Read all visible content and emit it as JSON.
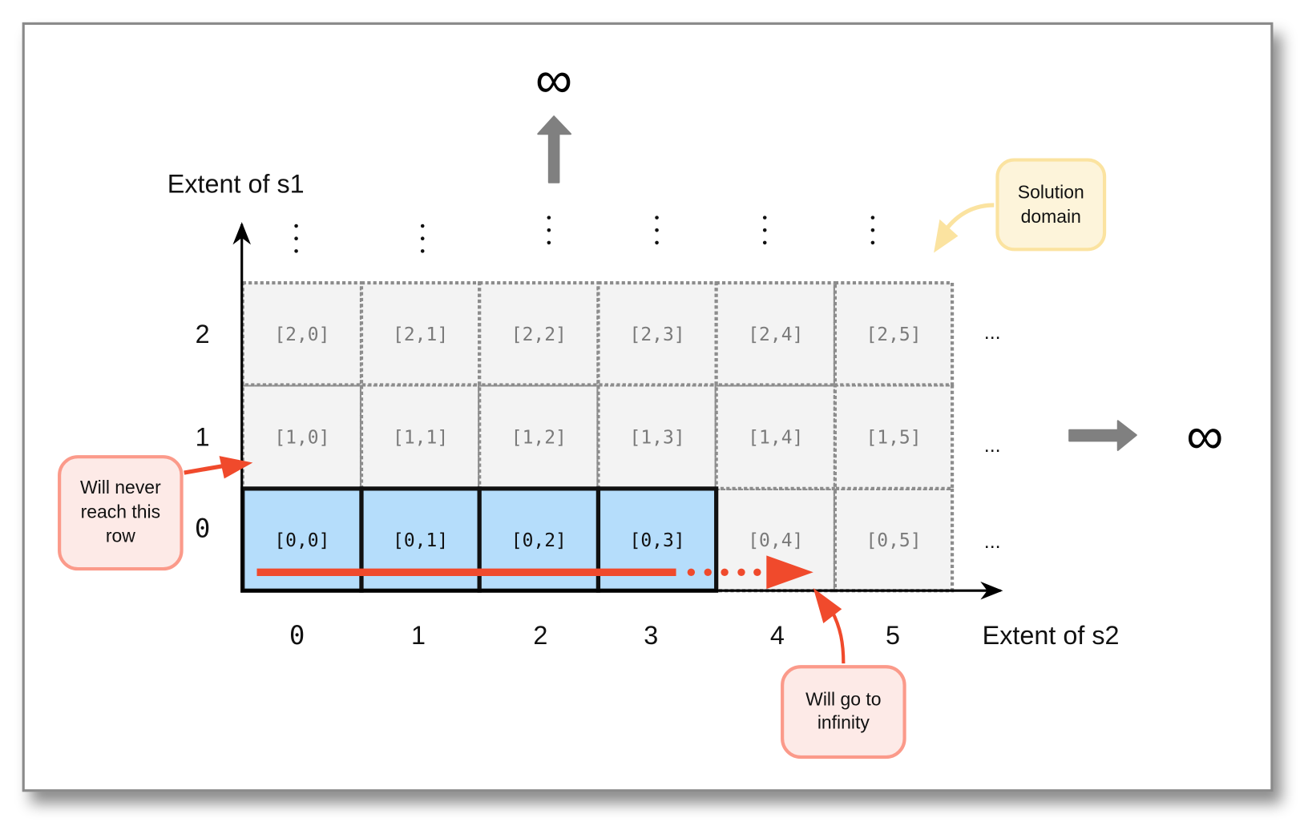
{
  "axes": {
    "y_label": "Extent of s1",
    "x_label": "Extent of s2",
    "row_ticks": [
      "0",
      "1",
      "2"
    ],
    "col_ticks": [
      "0",
      "1",
      "2",
      "3",
      "4",
      "5"
    ],
    "infinity_symbol": "∞",
    "ellipsis": "..."
  },
  "grid": {
    "rows": [
      [
        "[0,0]",
        "[0,1]",
        "[0,2]",
        "[0,3]",
        "[0,4]",
        "[0,5]"
      ],
      [
        "[1,0]",
        "[1,1]",
        "[1,2]",
        "[1,3]",
        "[1,4]",
        "[1,5]"
      ],
      [
        "[2,0]",
        "[2,1]",
        "[2,2]",
        "[2,3]",
        "[2,4]",
        "[2,5]"
      ]
    ],
    "highlighted_row": 0,
    "highlighted_cells": 4
  },
  "callouts": {
    "solution_domain": [
      "Solution",
      "domain"
    ],
    "never_reach": [
      "Will never",
      "reach this",
      "row"
    ],
    "go_infinity": [
      "Will go to",
      "infinity"
    ]
  },
  "colors": {
    "highlight_fill": "#b5ddfb",
    "cell_fill": "#f3f3f3",
    "red_accent": "#f04a2c",
    "red_box_fill": "#fdeae7",
    "red_box_stroke": "#fb9a8a",
    "yellow_box_fill": "#fdf4da",
    "yellow_box_stroke": "#fbe3a0",
    "gray_arrow": "#808080"
  }
}
